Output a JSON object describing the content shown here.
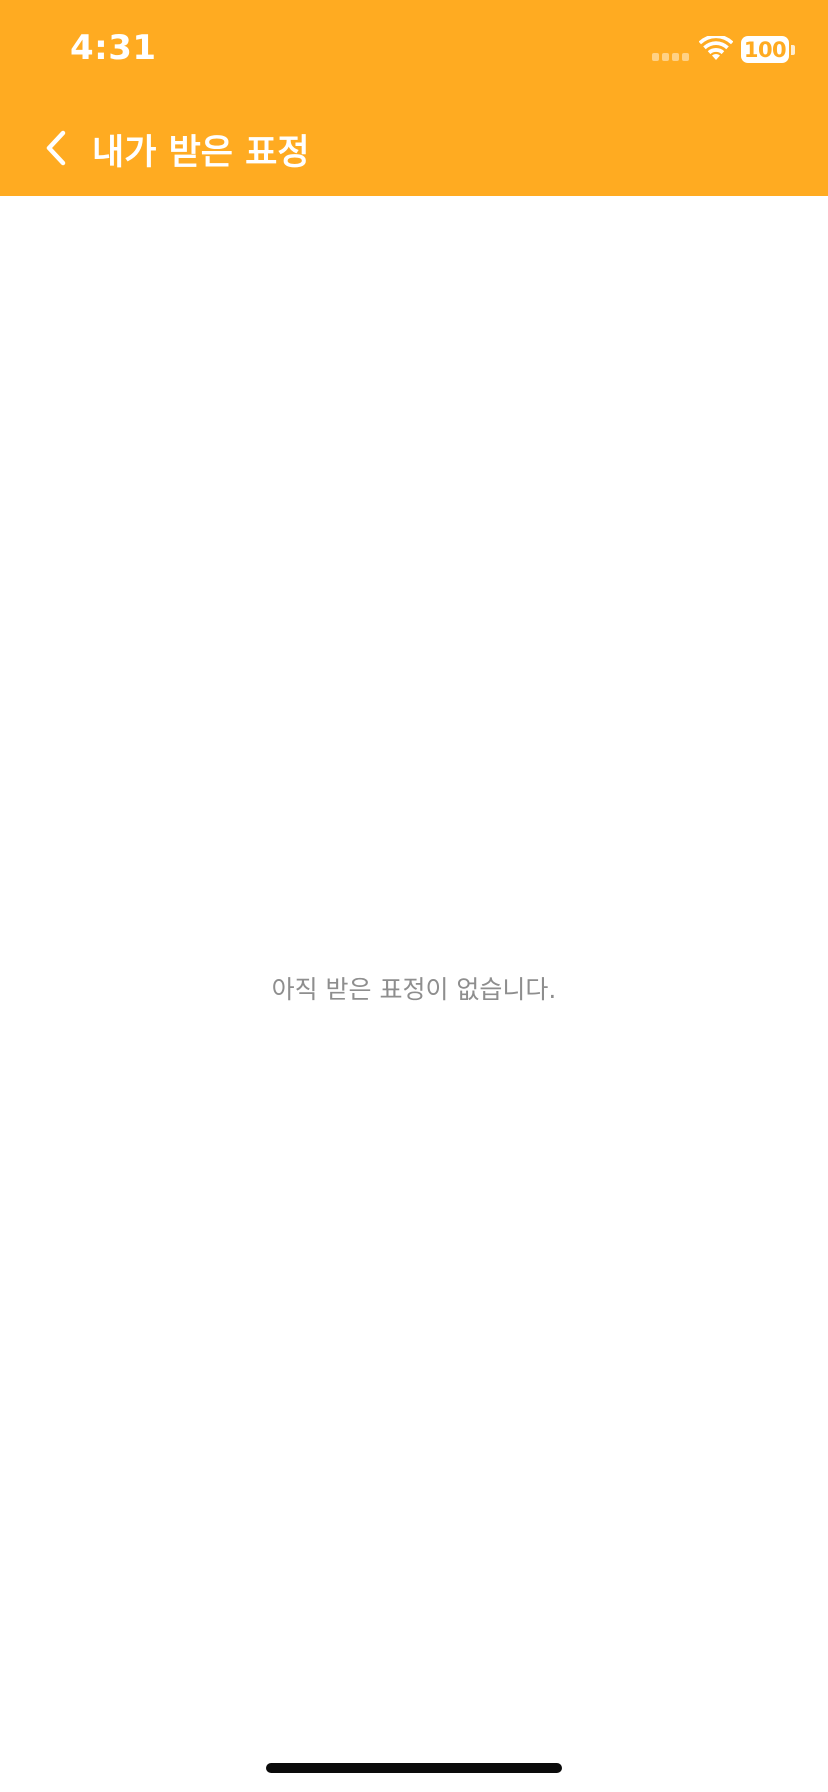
{
  "status_bar": {
    "time": "4:31",
    "battery_level": "100"
  },
  "nav": {
    "title": "내가 받은 표정",
    "back_icon": "chevron-left-icon"
  },
  "main": {
    "empty_message": "아직 받은 표정이 없습니다."
  },
  "colors": {
    "accent": "#FFAB21",
    "empty_text": "#8E8E8E",
    "background": "#FFFFFF"
  }
}
